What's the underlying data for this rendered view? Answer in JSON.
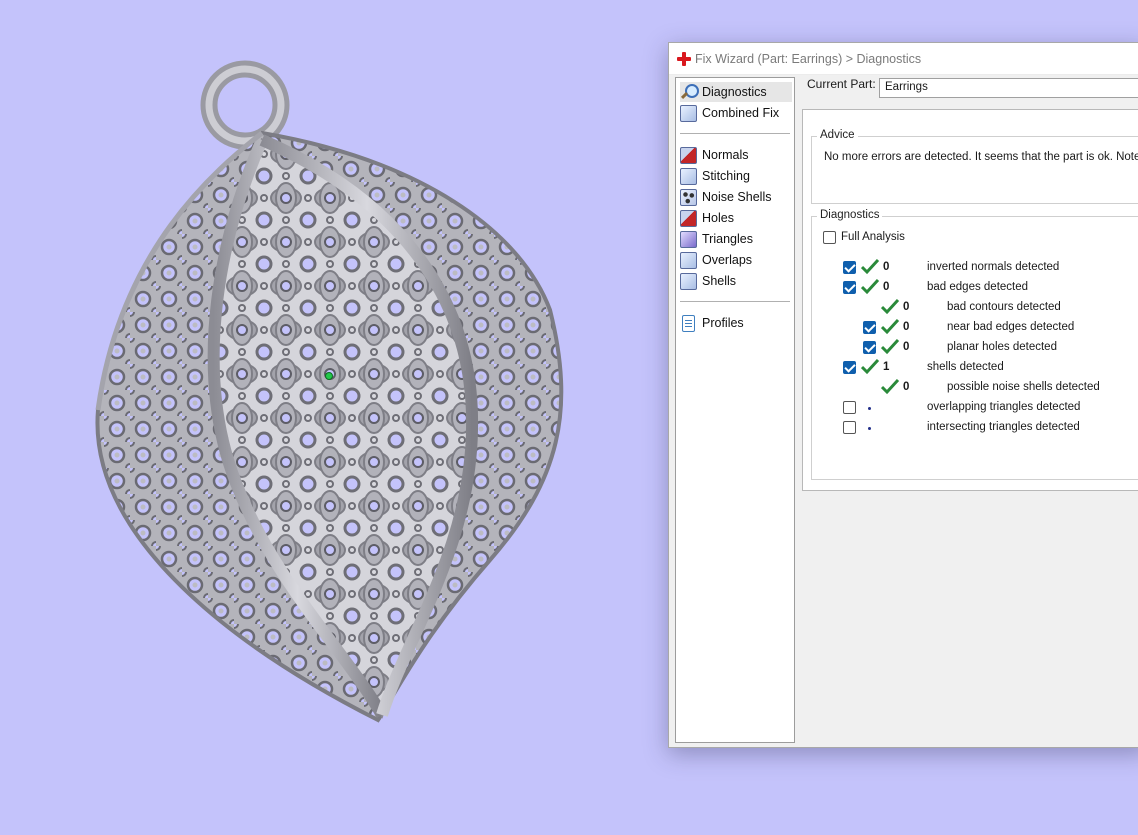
{
  "window": {
    "title": "Fix Wizard (Part: Earrings) > Diagnostics",
    "icon": "red-plus-icon"
  },
  "nav": {
    "items": [
      {
        "label": "Diagnostics",
        "icon": "magnifier-icon",
        "selected": true
      },
      {
        "label": "Combined Fix",
        "icon": "cube-icon",
        "selected": false
      },
      {
        "label": "Normals",
        "icon": "normals-cube-icon",
        "selected": false
      },
      {
        "label": "Stitching",
        "icon": "stitching-cube-icon",
        "selected": false
      },
      {
        "label": "Noise Shells",
        "icon": "noise-shells-icon",
        "selected": false
      },
      {
        "label": "Holes",
        "icon": "holes-cube-icon",
        "selected": false
      },
      {
        "label": "Triangles",
        "icon": "triangles-cube-icon",
        "selected": false
      },
      {
        "label": "Overlaps",
        "icon": "overlaps-cube-icon",
        "selected": false
      },
      {
        "label": "Shells",
        "icon": "shells-cube-icon",
        "selected": false
      },
      {
        "label": "Profiles",
        "icon": "document-icon",
        "selected": false
      }
    ]
  },
  "current_part": {
    "label": "Current Part:",
    "value": "Earrings"
  },
  "advice": {
    "title": "Advice",
    "text": "No more errors are detected. It seems that the part is ok. Note th"
  },
  "diagnostics": {
    "title": "Diagnostics",
    "full_analysis": {
      "label": "Full Analysis",
      "checked": false
    },
    "rows": [
      {
        "label": "inverted normals detected",
        "count": "0",
        "checked": true,
        "ok": true,
        "has_checkbox": true,
        "indent": 0
      },
      {
        "label": "bad edges detected",
        "count": "0",
        "checked": true,
        "ok": true,
        "has_checkbox": true,
        "indent": 0
      },
      {
        "label": "bad contours detected",
        "count": "0",
        "checked": false,
        "ok": true,
        "has_checkbox": false,
        "indent": 1
      },
      {
        "label": "near bad edges detected",
        "count": "0",
        "checked": true,
        "ok": true,
        "has_checkbox": true,
        "indent": 1
      },
      {
        "label": "planar holes detected",
        "count": "0",
        "checked": true,
        "ok": true,
        "has_checkbox": true,
        "indent": 1
      },
      {
        "label": "shells detected",
        "count": "1",
        "checked": true,
        "ok": true,
        "has_checkbox": true,
        "indent": 0
      },
      {
        "label": "possible noise shells detected",
        "count": "0",
        "checked": false,
        "ok": true,
        "has_checkbox": false,
        "indent": 1
      },
      {
        "label": "overlapping triangles detected",
        "count": "",
        "checked": false,
        "ok": false,
        "has_checkbox": true,
        "indent": 0
      },
      {
        "label": "intersecting triangles detected",
        "count": "",
        "checked": false,
        "ok": false,
        "has_checkbox": true,
        "indent": 0
      }
    ]
  },
  "colors": {
    "viewport_background": "#c4c3fb",
    "tick_green": "#2a8a3a",
    "checkbox_blue": "#0f5fad"
  }
}
